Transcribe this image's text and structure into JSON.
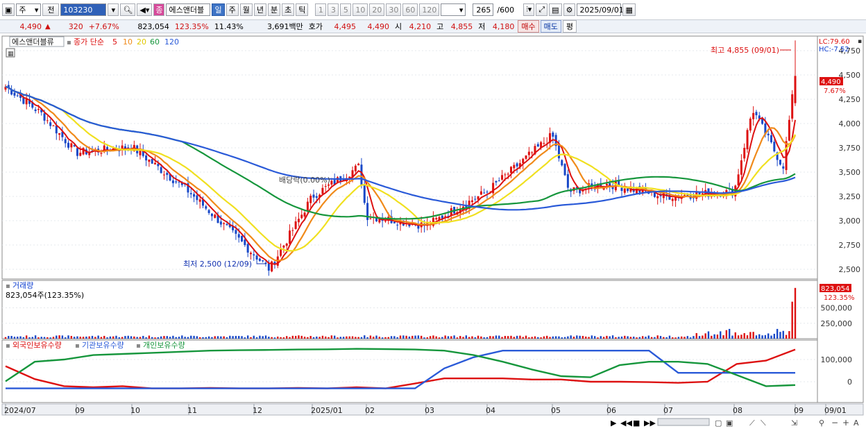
{
  "toolbar": {
    "mode": "주",
    "prev_label": "전",
    "code": "103230",
    "name_badge": "종",
    "stock_name": "에스앤더블",
    "periods": [
      "일",
      "주",
      "월",
      "년",
      "분",
      "초",
      "틱"
    ],
    "active_period": "일",
    "intervals": [
      "1",
      "3",
      "5",
      "10",
      "20",
      "30",
      "60",
      "120"
    ],
    "count": "265",
    "count_total": "/600",
    "date": "2025/09/01"
  },
  "quote": {
    "price": "4,490",
    "change_arrow": "▲",
    "change": "320",
    "change_pct": "+7.67%",
    "volume": "823,054",
    "volume_ratio": "123.35%",
    "turnover": "11.43%",
    "amount": "3,691백만",
    "ask_label": "호가",
    "ask": "4,495",
    "bid": "4,490",
    "open_label": "시",
    "open": "4,210",
    "high_label": "고",
    "high": "4,855",
    "low_label": "저",
    "low": "4,180",
    "buy_label": "매수",
    "sell_label": "매도",
    "avg_label": "평"
  },
  "price_panel": {
    "name_tab": "에스앤더블류",
    "legend_prefix": "종가 단순",
    "ma_periods": [
      "5",
      "10",
      "20",
      "60",
      "120"
    ],
    "ma_colors": [
      "#dd1111",
      "#f08a1a",
      "#f0e020",
      "#16963c",
      "#2a5ad8"
    ],
    "lc_label": "LC:79.60",
    "hc_label": "HC:-7.52",
    "current_price_label": "4,490",
    "current_pct_label": "7.67%",
    "high_annotation": "최고 4,855 (09/01)",
    "low_annotation": "최저 2,500 (12/09)",
    "dividend_annotation": "배당락(0.00%)",
    "y_ticks": [
      "4,750",
      "4,500",
      "4,250",
      "4,000",
      "3,750",
      "3,500",
      "3,250",
      "3,000",
      "2,750",
      "2,500"
    ]
  },
  "volume_panel": {
    "title": "거래량",
    "value_label": "823,054주(123.35%)",
    "current_label": "823,054",
    "current_pct": "123.35%",
    "y_ticks": [
      "500,000",
      "250,000"
    ]
  },
  "holdings_panel": {
    "series_labels": [
      "외국인보유수량",
      "기관보유수량",
      "개인보유수량"
    ],
    "series_colors": [
      "#dd1111",
      "#2a5ad8",
      "#16963c"
    ],
    "y_ticks": [
      "100,000",
      "0"
    ]
  },
  "x_axis": {
    "labels": [
      "2024/07",
      "09",
      "10",
      "11",
      "12",
      "2025/01",
      "02",
      "03",
      "04",
      "05",
      "06",
      "07",
      "08",
      "09",
      "09/01"
    ]
  },
  "chart_data": {
    "type": "candlestick",
    "x_range": [
      "2024/07",
      "2025/09/01"
    ],
    "ylim": [
      2400,
      4900
    ],
    "close_series": [
      {
        "x": "2024/07",
        "y": 4380
      },
      {
        "x": "2024/08",
        "y": 4100
      },
      {
        "x": "2024/09",
        "y": 3700
      },
      {
        "x": "2024/10",
        "y": 3760
      },
      {
        "x": "2024/11",
        "y": 3300
      },
      {
        "x": "2024/12/09",
        "y": 2500
      },
      {
        "x": "2025/01",
        "y": 3250
      },
      {
        "x": "2025/01/27",
        "y": 3560
      },
      {
        "x": "2025/02",
        "y": 3050
      },
      {
        "x": "2025/03",
        "y": 2950
      },
      {
        "x": "2025/04",
        "y": 3300
      },
      {
        "x": "2025/05",
        "y": 3880
      },
      {
        "x": "2025/05/10",
        "y": 3300
      },
      {
        "x": "2025/06",
        "y": 3380
      },
      {
        "x": "2025/07",
        "y": 3250
      },
      {
        "x": "2025/08",
        "y": 3300
      },
      {
        "x": "2025/08/10",
        "y": 4150
      },
      {
        "x": "2025/08/25",
        "y": 3550
      },
      {
        "x": "2025/09/01",
        "y": 4490
      }
    ],
    "last_bar": {
      "open": 4210,
      "high": 4855,
      "low": 4180,
      "close": 4490,
      "volume": 823054
    },
    "holdings_series": [
      {
        "name": "외국인보유수량",
        "values": [
          70000,
          12000,
          -20000,
          -25000,
          -20000,
          -30000,
          -30000,
          -28000,
          -30000,
          -30000,
          -28000,
          -30000,
          -25000,
          -30000,
          -8000,
          15000,
          15000,
          15000,
          10000,
          10000,
          0,
          0,
          -2000,
          -5000,
          0,
          80000,
          95000,
          145000
        ]
      },
      {
        "name": "기관보유수량",
        "values": [
          -30000,
          -30000,
          -30000,
          -30000,
          -30000,
          -30000,
          -30000,
          -30000,
          -30000,
          -30000,
          -30000,
          -30000,
          -30000,
          -30000,
          -30000,
          60000,
          110000,
          140000,
          140000,
          140000,
          140000,
          140000,
          140000,
          40000,
          40000,
          40000,
          40000,
          40000
        ]
      },
      {
        "name": "개인보유수량",
        "values": [
          2000,
          90000,
          100000,
          120000,
          125000,
          130000,
          135000,
          140000,
          142000,
          143000,
          145000,
          146000,
          148000,
          147000,
          145000,
          140000,
          120000,
          90000,
          55000,
          25000,
          20000,
          75000,
          90000,
          90000,
          80000,
          30000,
          -20000,
          -15000
        ]
      }
    ]
  }
}
